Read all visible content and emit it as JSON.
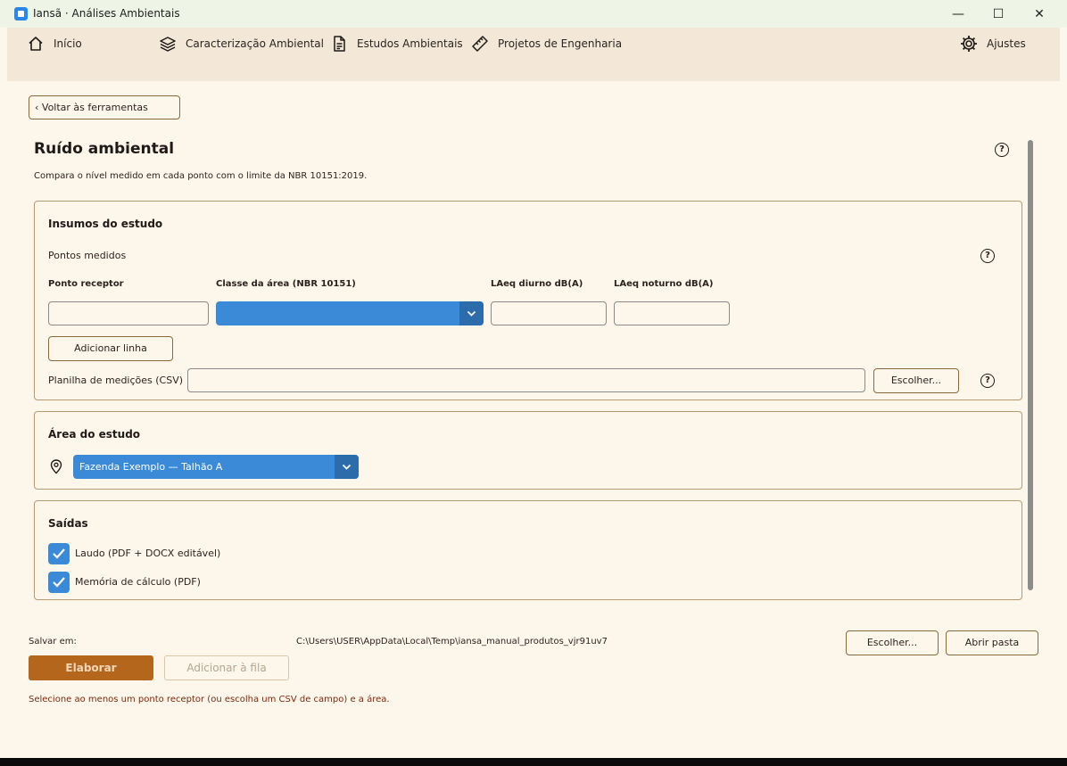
{
  "window": {
    "title": "Iansã · Análises Ambientais",
    "controls": [
      "—",
      "☐",
      "✕"
    ]
  },
  "nav": {
    "items": [
      {
        "label": "Início",
        "icon": "home-icon"
      },
      {
        "label": "Caracterização Ambiental",
        "icon": "layers-icon"
      },
      {
        "label": "Estudos Ambientais",
        "icon": "document-icon"
      },
      {
        "label": "Projetos de Engenharia",
        "icon": "ruler-icon"
      }
    ],
    "settings": {
      "label": "Ajustes",
      "icon": "gear-icon"
    }
  },
  "back_label": "‹ Voltar às ferramentas",
  "page": {
    "title": "Ruído ambiental",
    "description": "Compara o nível medido em cada ponto com o limite da NBR 10151:2019."
  },
  "inputs_panel": {
    "title": "Insumos do estudo",
    "points_label": "Pontos medidos",
    "columns": [
      "Ponto receptor",
      "Classe da área (NBR 10151)",
      "LAeq diurno dB(A)",
      "LAeq noturno dB(A)"
    ],
    "row": {
      "ponto": "",
      "classe": "",
      "diurno": "",
      "noturno": ""
    },
    "add_row_label": "Adicionar linha",
    "csv_label": "Planilha de medições (CSV)",
    "csv_value": "",
    "choose_label": "Escolher..."
  },
  "area_panel": {
    "title": "Área do estudo",
    "selected": "Fazenda Exemplo — Talhão A",
    "icon": "map-pin-icon"
  },
  "outputs_panel": {
    "title": "Saídas",
    "options": [
      {
        "label": "Laudo (PDF + DOCX editável)",
        "checked": true
      },
      {
        "label": "Memória de cálculo (PDF)",
        "checked": true
      }
    ]
  },
  "footer": {
    "save_label": "Salvar em:",
    "save_path": "C:\\Users\\USER\\AppData\\Local\\Temp\\iansa_manual_produtos_vjr91uv7",
    "choose_label": "Escolher...",
    "open_folder_label": "Abrir pasta",
    "elaborate_label": "Elaborar",
    "queue_label": "Adicionar à fila",
    "warning": "Selecione ao menos um ponto receptor (ou escolha um CSV de campo) e a área."
  },
  "colors": {
    "accent": "#3a8ad8",
    "primary": "#b5661d",
    "background": "#fdf6ea",
    "nav": "#f3e8d8"
  }
}
